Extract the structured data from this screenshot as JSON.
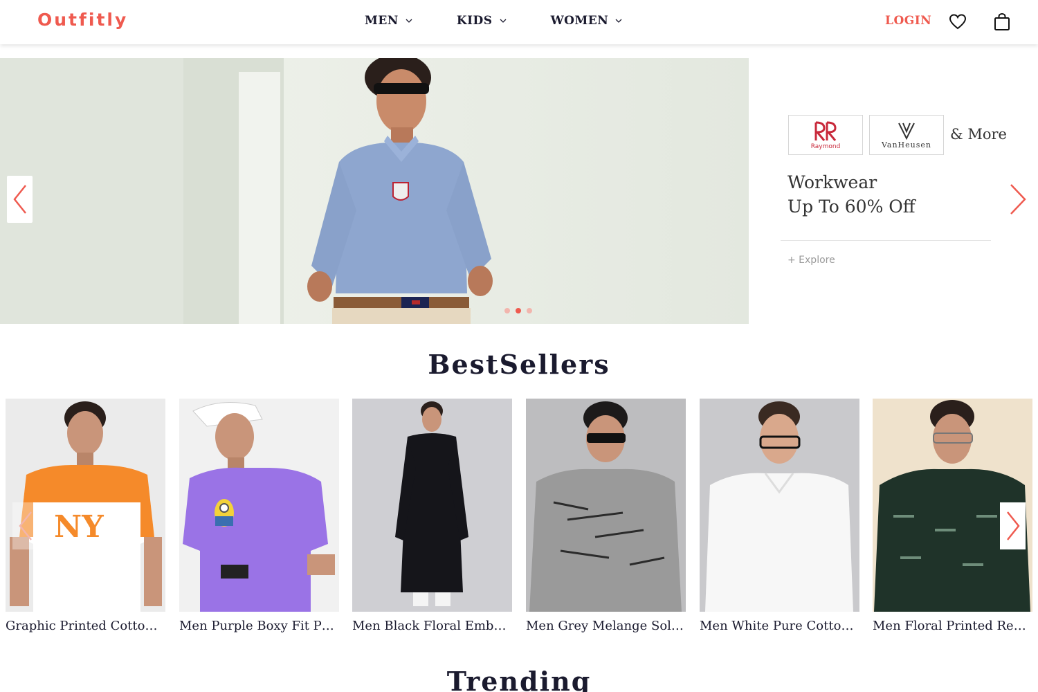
{
  "header": {
    "logo": "Outfitly",
    "nav": [
      {
        "label": "MEN"
      },
      {
        "label": "KIDS"
      },
      {
        "label": "WOMEN"
      }
    ],
    "login_label": "LOGIN",
    "icons": [
      "heart-icon",
      "bag-icon"
    ]
  },
  "hero": {
    "brands": [
      "Raymond",
      "VanHeusen"
    ],
    "more_label": "& More",
    "promo_line1": "Workwear",
    "promo_line2": "Up To 60% Off",
    "explore_label": "+ Explore",
    "slide_count": 3,
    "active_slide": 2
  },
  "bestsellers": {
    "title": "BestSellers",
    "products": [
      {
        "name": "Graphic Printed Cotton T..."
      },
      {
        "name": "Men Purple Boxy Fit Prin..."
      },
      {
        "name": "Men Black Floral Embroi..."
      },
      {
        "name": "Men Grey Melange Solid ..."
      },
      {
        "name": "Men White Pure Cotton T..."
      },
      {
        "name": "Men Floral Printed Regul..."
      }
    ]
  },
  "trending": {
    "title": "Trending"
  },
  "colors": {
    "accent": "#ef5a4f",
    "text": "#1a1a2e"
  }
}
